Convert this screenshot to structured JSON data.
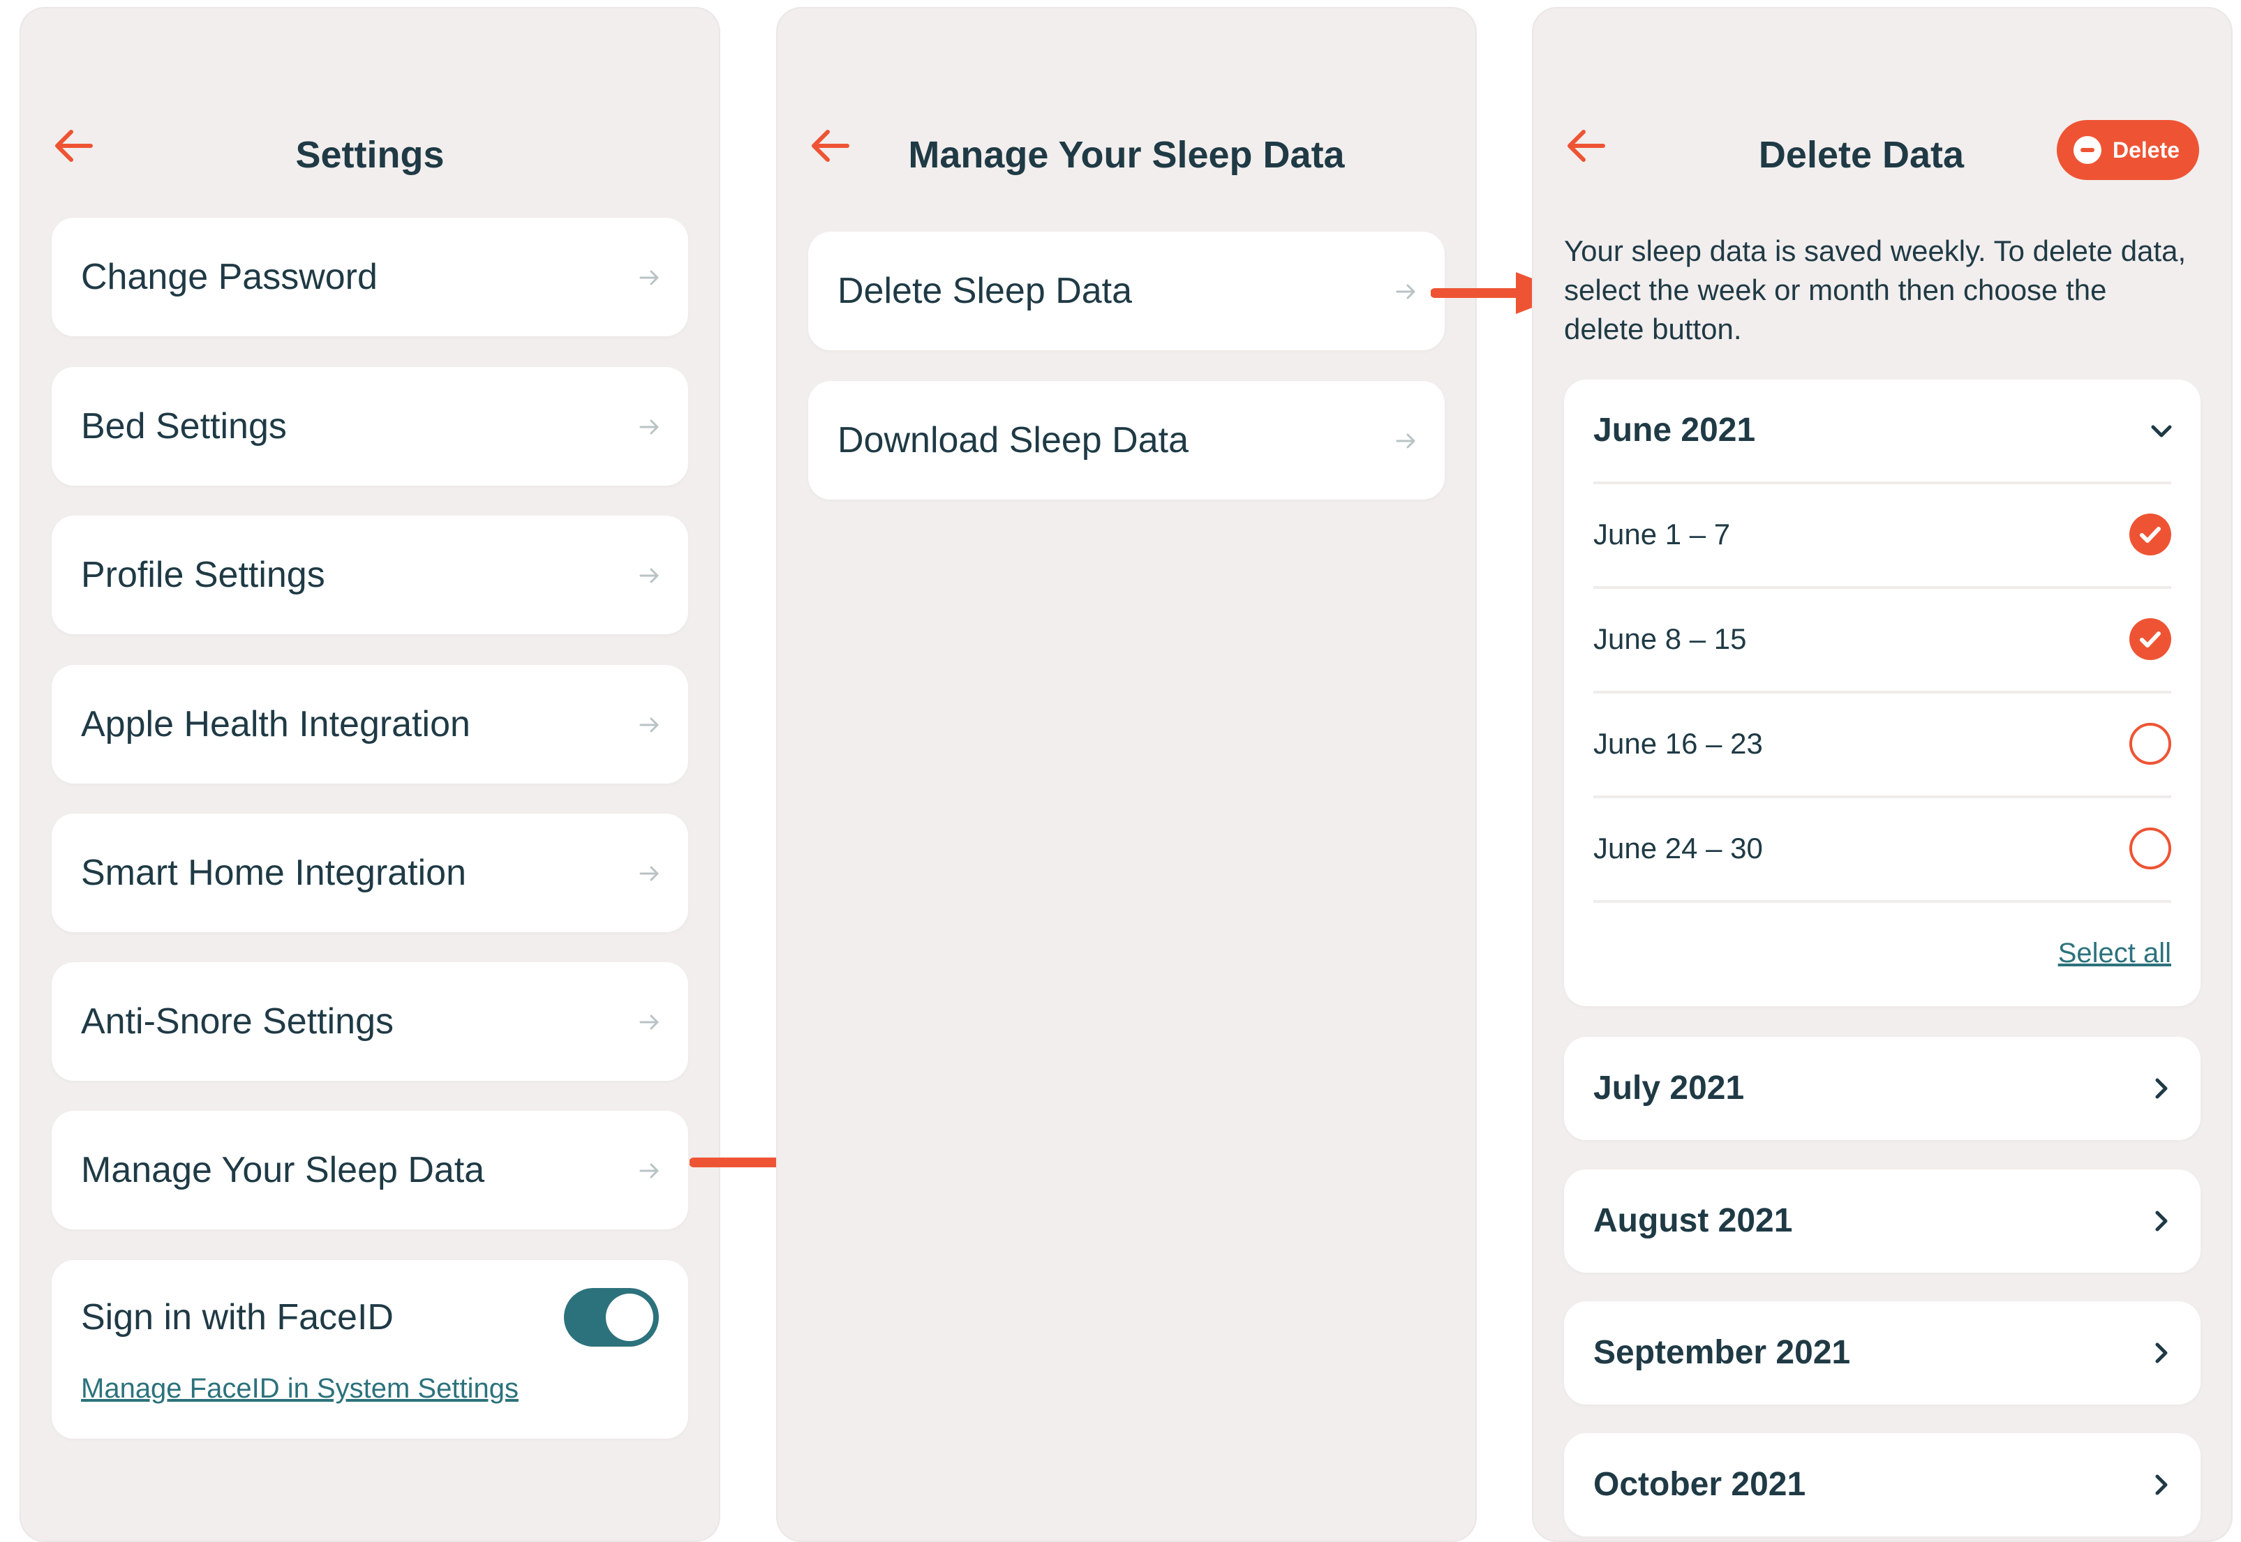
{
  "colors": {
    "accent": "#ee5434",
    "teal": "#2c727c",
    "text": "#1f3a45",
    "background": "#f2eeed",
    "card": "#ffffff"
  },
  "settings": {
    "title": "Settings",
    "items": [
      {
        "label": "Change Password"
      },
      {
        "label": "Bed Settings"
      },
      {
        "label": "Profile Settings"
      },
      {
        "label": "Apple Health Integration"
      },
      {
        "label": "Smart Home Integration"
      },
      {
        "label": "Anti-Snore Settings"
      },
      {
        "label": "Manage Your Sleep Data"
      }
    ],
    "faceid": {
      "label": "Sign in with FaceID",
      "enabled": true,
      "link": "Manage FaceID in System Settings"
    }
  },
  "manage": {
    "title": "Manage Your Sleep Data",
    "items": [
      {
        "label": "Delete Sleep Data"
      },
      {
        "label": "Download Sleep Data"
      }
    ]
  },
  "delete": {
    "title": "Delete Data",
    "button": "Delete",
    "description": "Your sleep data is saved weekly.  To delete data, select the week or month then choose the delete button.",
    "expanded_month": {
      "label": "June 2021",
      "weeks": [
        {
          "label": "June 1 – 7",
          "checked": true
        },
        {
          "label": "June 8 – 15",
          "checked": true
        },
        {
          "label": "June 16 – 23",
          "checked": false
        },
        {
          "label": "June 24 – 30",
          "checked": false
        }
      ],
      "select_all": "Select all"
    },
    "months": [
      {
        "label": "July 2021"
      },
      {
        "label": "August 2021"
      },
      {
        "label": "September 2021"
      },
      {
        "label": "October 2021"
      }
    ]
  },
  "icons": {
    "back": "arrow-left-icon",
    "row": "arrow-right-icon",
    "expanded": "chevron-down-icon",
    "collapsed": "chevron-right-icon",
    "checked": "check-circle-icon",
    "unchecked": "empty-circle-icon",
    "delete": "minus-circle-icon"
  }
}
